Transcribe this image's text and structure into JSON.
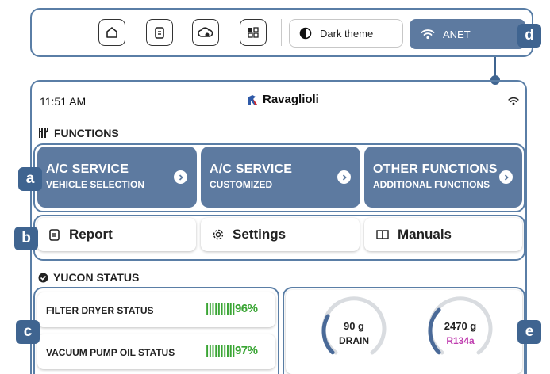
{
  "toolbar": {
    "buttons": [
      {
        "icon": "home-icon"
      },
      {
        "icon": "clipboard-icon"
      },
      {
        "icon": "cloud-settings-icon"
      },
      {
        "icon": "grid-icon"
      }
    ],
    "theme_label": "Dark theme",
    "network_label": "ANET"
  },
  "callouts": {
    "a": "a",
    "b": "b",
    "c": "c",
    "d": "d",
    "e": "e"
  },
  "status_bar": {
    "time": "11:51 AM",
    "brand": "Ravaglioli"
  },
  "functions": {
    "title": "FUNCTIONS",
    "cards": [
      {
        "title": "A/C SERVICE",
        "subtitle": "VEHICLE SELECTION"
      },
      {
        "title": "A/C SERVICE",
        "subtitle": "CUSTOMIZED"
      },
      {
        "title": "OTHER FUNCTIONS",
        "subtitle": "ADDITIONAL FUNCTIONS"
      }
    ]
  },
  "tools": [
    {
      "label": "Report",
      "icon": "report-icon"
    },
    {
      "label": "Settings",
      "icon": "gear-icon"
    },
    {
      "label": "Manuals",
      "icon": "book-icon"
    }
  ],
  "yucon": {
    "title": "YUCON STATUS",
    "items": [
      {
        "label": "FILTER DRYER STATUS",
        "value": "96%",
        "bars": "||||||||||"
      },
      {
        "label": "VACUUM PUMP OIL STATUS",
        "value": "97%",
        "bars": "||||||||||"
      }
    ],
    "gauges": [
      {
        "value": "90 g",
        "label": "DRAIN",
        "fraction": 0.25
      },
      {
        "value": "2470 g",
        "label": "R134a",
        "fraction": 0.3
      }
    ]
  },
  "colors": {
    "accent": "#5d7aa0",
    "badge": "#3f6490",
    "ok_green": "#3aa534",
    "refrigerant": "#c03fb0"
  }
}
